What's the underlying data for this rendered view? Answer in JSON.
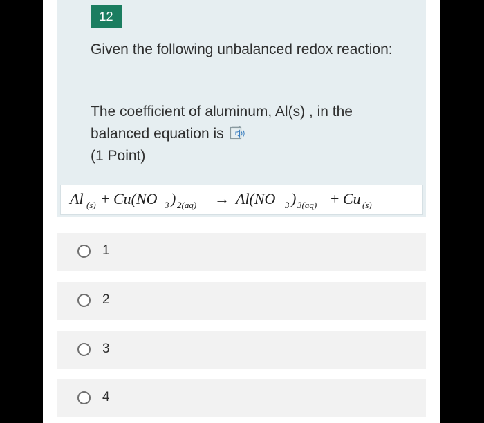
{
  "question": {
    "number": "12",
    "title": "Given the following unbalanced redox reaction:",
    "prompt": "The coefficient of aluminum, Al(s) , in the balanced equation is",
    "points": "(1 Point)"
  },
  "equation": {
    "reactant1": "Al",
    "reactant1_state": "(s)",
    "plus": "+",
    "reactant2": "Cu(NO",
    "reactant2_sub": "3",
    "reactant2_close": ")",
    "reactant2_state": "2(aq)",
    "arrow": "→",
    "product1": "Al(NO",
    "product1_sub": "3",
    "product1_close": ")",
    "product1_state": "3(aq)",
    "plus2": "+",
    "product2": "Cu",
    "product2_state": "(s)"
  },
  "options": [
    {
      "label": "1"
    },
    {
      "label": "2"
    },
    {
      "label": "3"
    },
    {
      "label": "4"
    }
  ],
  "icons": {
    "speaker": "immersive-reader-speaker-icon",
    "radio": "radio-unselected-icon"
  },
  "colors": {
    "accent": "#1b7d60",
    "panel": "#e6eef1",
    "option_bg": "#f2f2f2",
    "text": "#2f2f2f"
  }
}
